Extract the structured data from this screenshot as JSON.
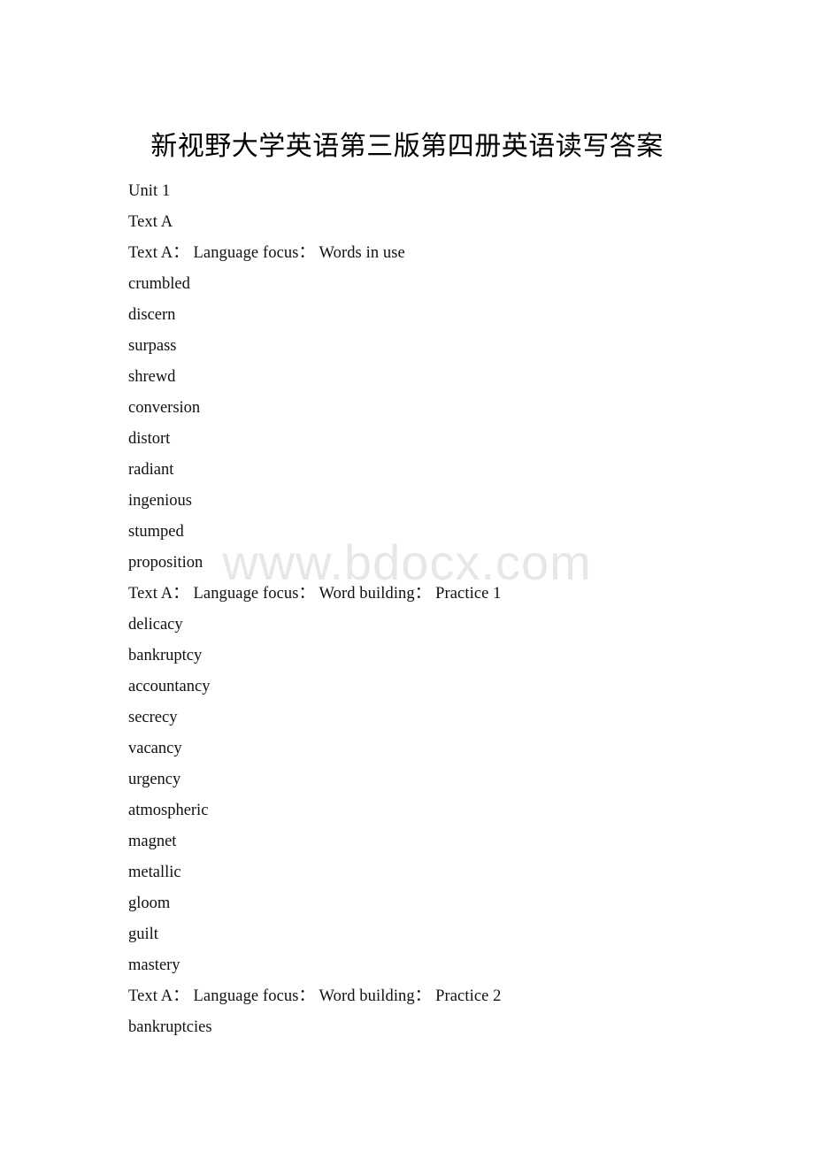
{
  "document": {
    "title": "新视野大学英语第三版第四册英语读写答案",
    "watermark": "www.bdocx.com",
    "background_color": "#ffffff",
    "text_color": "#000000",
    "watermark_color": "#e6e7e8"
  },
  "lines": [
    {
      "text": "Unit 1",
      "kind": "heading"
    },
    {
      "text": "Text A",
      "kind": "heading"
    },
    {
      "text": "Text A：  Language focus：  Words in use",
      "kind": "heading"
    },
    {
      "text": "crumbled",
      "kind": "answer"
    },
    {
      "text": "discern",
      "kind": "answer"
    },
    {
      "text": "surpass",
      "kind": "answer"
    },
    {
      "text": "shrewd",
      "kind": "answer"
    },
    {
      "text": "conversion",
      "kind": "answer"
    },
    {
      "text": "distort",
      "kind": "answer"
    },
    {
      "text": "radiant",
      "kind": "answer"
    },
    {
      "text": "ingenious",
      "kind": "answer"
    },
    {
      "text": "stumped",
      "kind": "answer"
    },
    {
      "text": "proposition",
      "kind": "answer"
    },
    {
      "text": "Text A：  Language focus：  Word building：  Practice 1",
      "kind": "heading"
    },
    {
      "text": "delicacy",
      "kind": "answer"
    },
    {
      "text": "bankruptcy",
      "kind": "answer"
    },
    {
      "text": "accountancy",
      "kind": "answer"
    },
    {
      "text": "secrecy",
      "kind": "answer"
    },
    {
      "text": "vacancy",
      "kind": "answer"
    },
    {
      "text": "urgency",
      "kind": "answer"
    },
    {
      "text": "atmospheric",
      "kind": "answer"
    },
    {
      "text": "magnet",
      "kind": "answer"
    },
    {
      "text": "metallic",
      "kind": "answer"
    },
    {
      "text": "gloom",
      "kind": "answer"
    },
    {
      "text": "guilt",
      "kind": "answer"
    },
    {
      "text": "mastery",
      "kind": "answer"
    },
    {
      "text": "Text A：  Language focus：  Word building：  Practice 2",
      "kind": "heading"
    },
    {
      "text": "bankruptcies",
      "kind": "answer"
    }
  ]
}
